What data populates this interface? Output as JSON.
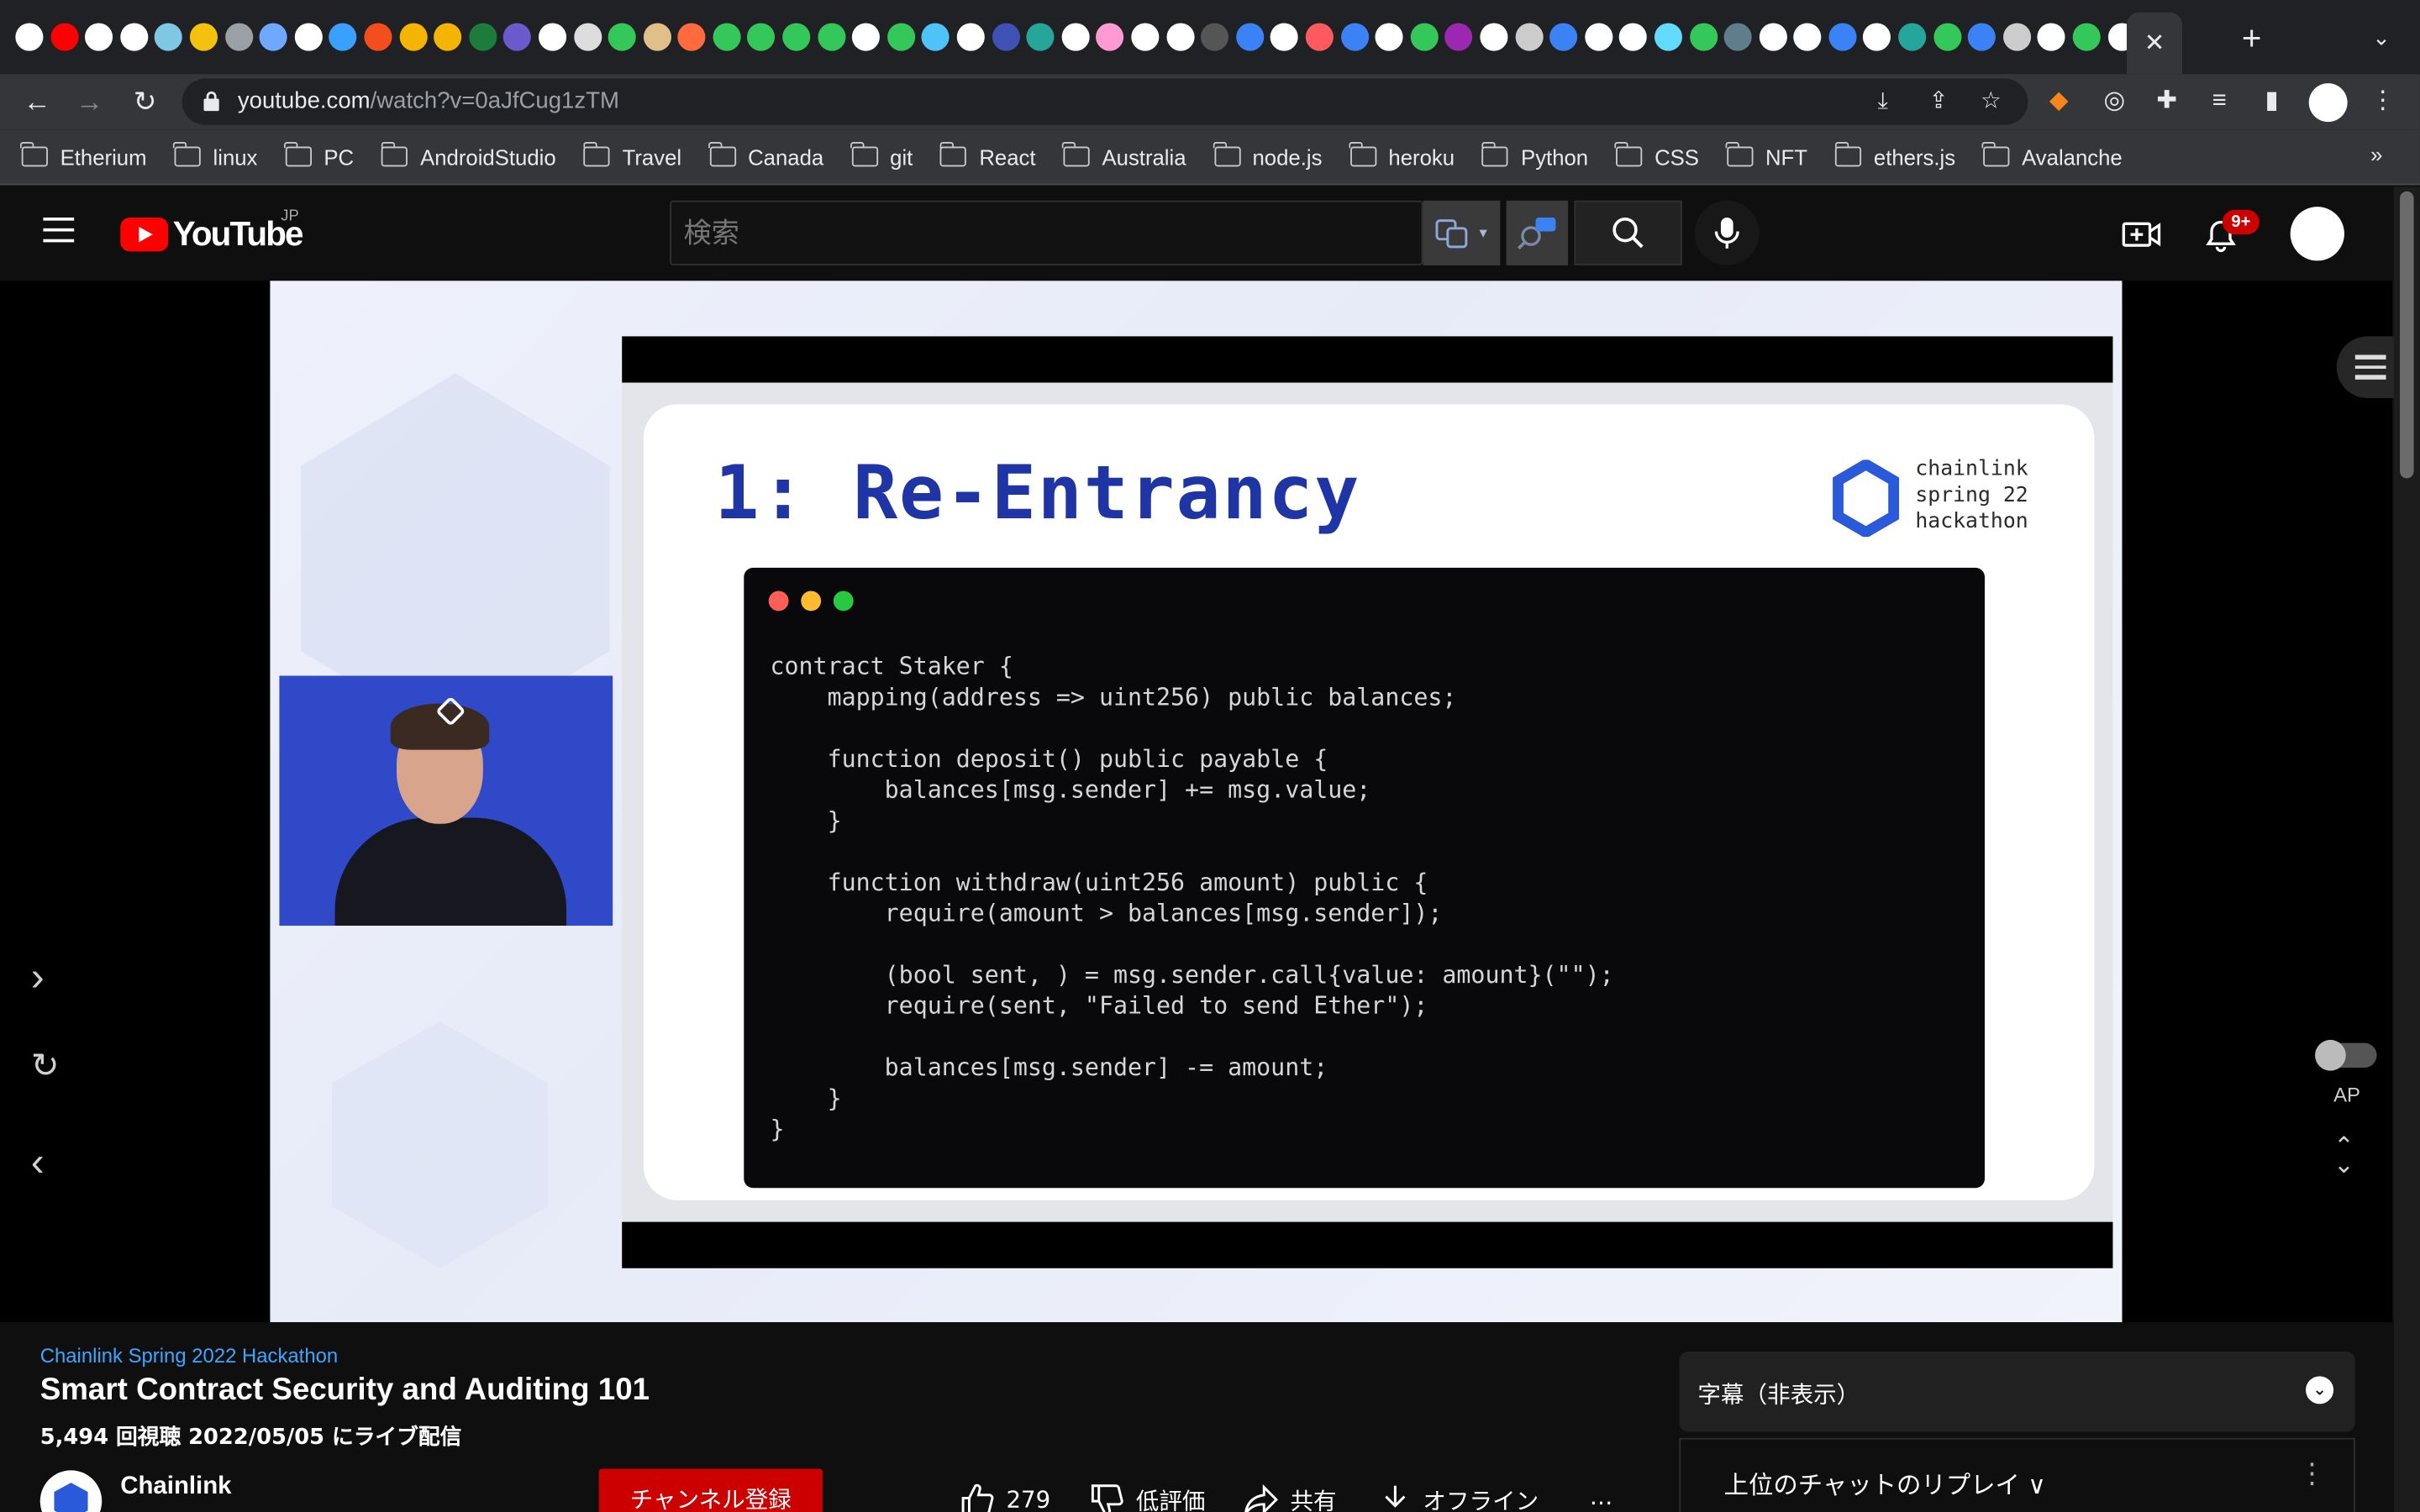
{
  "browser": {
    "tab_favicons": [
      {
        "name": "github-icon",
        "bg": "#ffffff"
      },
      {
        "name": "youtube-icon",
        "bg": "#ff0000"
      },
      {
        "name": "app-icon",
        "bg": "#ffffff"
      },
      {
        "name": "github-icon",
        "bg": "#ffffff"
      },
      {
        "name": "app-icon",
        "bg": "#7ec8e3"
      },
      {
        "name": "warning-icon",
        "bg": "#f4c20d"
      },
      {
        "name": "doc-icon",
        "bg": "#9aa0a6"
      },
      {
        "name": "butterfly-icon",
        "bg": "#6ea8ff"
      },
      {
        "name": "chrome-icon",
        "bg": "#ffffff"
      },
      {
        "name": "vscode-icon",
        "bg": "#3aa0ff"
      },
      {
        "name": "figma-icon",
        "bg": "#f24e1e"
      },
      {
        "name": "app-icon",
        "bg": "#f5b400"
      },
      {
        "name": "app-icon",
        "bg": "#f5b400"
      },
      {
        "name": "app-icon",
        "bg": "#1c7c3c"
      },
      {
        "name": "app-icon",
        "bg": "#6a5acd"
      },
      {
        "name": "github-icon",
        "bg": "#ffffff"
      },
      {
        "name": "app-icon",
        "bg": "#dddddd"
      },
      {
        "name": "app-icon",
        "bg": "#34c759"
      },
      {
        "name": "app-icon",
        "bg": "#e0c088"
      },
      {
        "name": "app-icon",
        "bg": "#ff6b3d"
      },
      {
        "name": "app-icon",
        "bg": "#34c759"
      },
      {
        "name": "app-icon",
        "bg": "#34c759"
      },
      {
        "name": "app-icon",
        "bg": "#34c759"
      },
      {
        "name": "app-icon",
        "bg": "#34c759"
      },
      {
        "name": "github-icon",
        "bg": "#ffffff"
      },
      {
        "name": "app-icon",
        "bg": "#34c759"
      },
      {
        "name": "app-icon",
        "bg": "#4fc3f7"
      },
      {
        "name": "google-icon",
        "bg": "#ffffff"
      },
      {
        "name": "app-icon",
        "bg": "#3f51b5"
      },
      {
        "name": "app-icon",
        "bg": "#26a69a"
      },
      {
        "name": "app-icon",
        "bg": "#ffffff"
      },
      {
        "name": "app-icon",
        "bg": "#ff9ad5"
      },
      {
        "name": "notion-icon",
        "bg": "#ffffff"
      },
      {
        "name": "github-icon",
        "bg": "#ffffff"
      },
      {
        "name": "app-icon",
        "bg": "#555555"
      },
      {
        "name": "app-icon",
        "bg": "#3b82f6"
      },
      {
        "name": "chrome-icon",
        "bg": "#ffffff"
      },
      {
        "name": "app-icon",
        "bg": "#ff5a5f"
      },
      {
        "name": "app-icon",
        "bg": "#3b82f6"
      },
      {
        "name": "github-icon",
        "bg": "#ffffff"
      },
      {
        "name": "app-icon",
        "bg": "#34c759"
      },
      {
        "name": "app-icon",
        "bg": "#9c27b0"
      },
      {
        "name": "chrome-icon",
        "bg": "#ffffff"
      },
      {
        "name": "app-icon",
        "bg": "#cccccc"
      },
      {
        "name": "app-icon",
        "bg": "#3b82f6"
      },
      {
        "name": "app-icon",
        "bg": "#ffffff"
      },
      {
        "name": "google-icon",
        "bg": "#ffffff"
      },
      {
        "name": "react-icon",
        "bg": "#61dafb"
      },
      {
        "name": "app-icon",
        "bg": "#34c759"
      },
      {
        "name": "app-icon",
        "bg": "#607d8b"
      },
      {
        "name": "github-icon",
        "bg": "#ffffff"
      },
      {
        "name": "notion-icon",
        "bg": "#ffffff"
      },
      {
        "name": "app-icon",
        "bg": "#3b82f6"
      },
      {
        "name": "chrome-icon",
        "bg": "#ffffff"
      },
      {
        "name": "app-icon",
        "bg": "#26a69a"
      },
      {
        "name": "app-icon",
        "bg": "#34c759"
      },
      {
        "name": "app-icon",
        "bg": "#3b82f6"
      },
      {
        "name": "app-icon",
        "bg": "#cccccc"
      },
      {
        "name": "app-icon",
        "bg": "#ffffff"
      },
      {
        "name": "app-icon",
        "bg": "#34c759"
      },
      {
        "name": "app-icon",
        "bg": "#ffffff"
      },
      {
        "name": "app-icon",
        "bg": "#e8e0c8"
      }
    ],
    "active_tab_close": "✕",
    "new_tab": "+",
    "url_host": "youtube.com",
    "url_path": "/watch?v=0aJfCug1zTM",
    "bookmarks": [
      "Etherium",
      "linux",
      "PC",
      "AndroidStudio",
      "Travel",
      "Canada",
      "git",
      "React",
      "Australia",
      "node.js",
      "heroku",
      "Python",
      "CSS",
      "NFT",
      "ethers.js",
      "Avalanche"
    ],
    "bookmarks_more": "»"
  },
  "youtube": {
    "logo_text": "YouTube",
    "region": "JP",
    "search_placeholder": "検索",
    "notification_count": "9+"
  },
  "slide": {
    "title": "1: Re-Entrancy",
    "brand_lines": [
      "chainlink",
      "spring 22",
      "hackathon"
    ],
    "code_lines": [
      "contract Staker {",
      "    mapping(address => uint256) public balances;",
      "",
      "    function deposit() public payable {",
      "        balances[msg.sender] += msg.value;",
      "    }",
      "",
      "    function withdraw(uint256 amount) public {",
      "        require(amount > balances[msg.sender]);",
      "",
      "        (bool sent, ) = msg.sender.call{value: amount}(\"\");",
      "        require(sent, \"Failed to send Ether\");",
      "",
      "        balances[msg.sender] -= amount;",
      "    }",
      "}"
    ]
  },
  "player_side": {
    "autoplay_label": "AP"
  },
  "video": {
    "tagline": "Chainlink Spring 2022 Hackathon",
    "title": "Smart Contract Security and Auditing 101",
    "meta": "5,494 回視聴  2022/05/05 にライブ配信",
    "channel": "Chainlink",
    "subscribe_label": "チャンネル登録",
    "likes": "279",
    "dislike_label": "低評価",
    "share_label": "共有",
    "offline_label": "オフライン",
    "more_label": "…"
  },
  "side_panels": {
    "captions_label": "字幕（非表示）",
    "chat_replay_label": "上位のチャットのリプレイ ∨",
    "chat_more": "⋮"
  }
}
